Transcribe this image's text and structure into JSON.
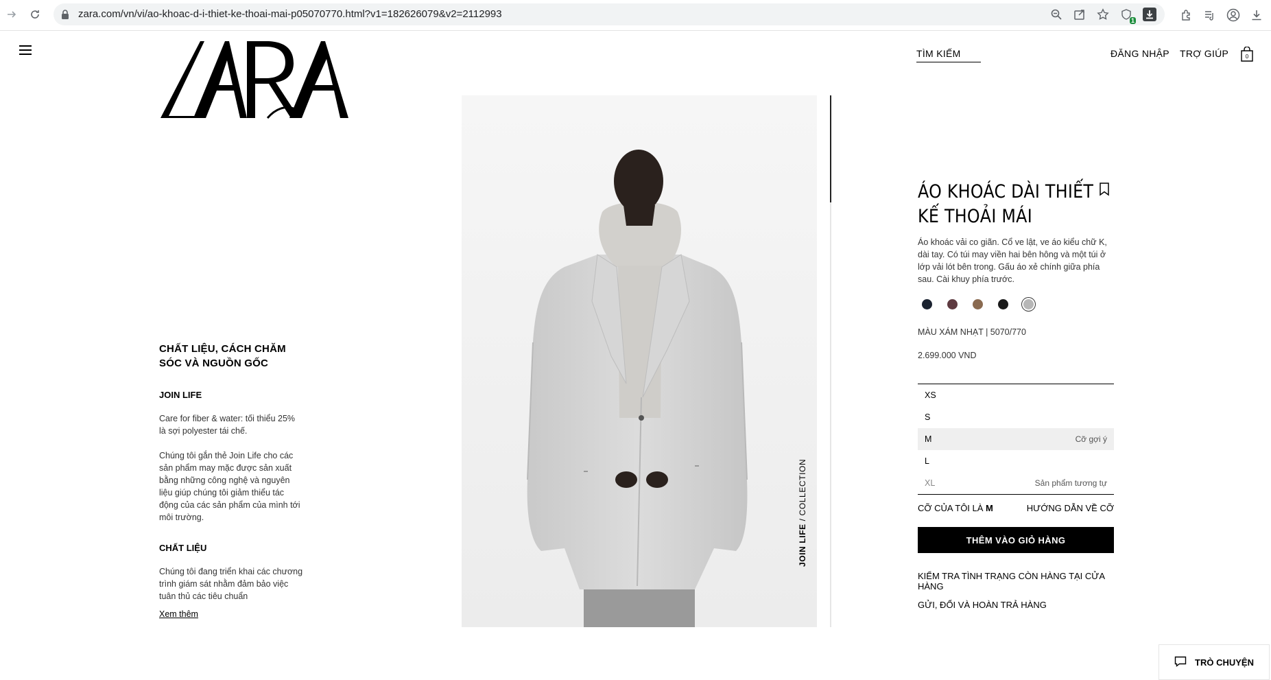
{
  "browser": {
    "url": "zara.com/vn/vi/ao-khoac-d-i-thiet-ke-thoai-mai-p05070770.html?v1=182626079&v2=2112993",
    "extension_badge": "1"
  },
  "header": {
    "logo_text": "ZARA",
    "search": "TÌM KIẾM",
    "login": "ĐĂNG NHẬP",
    "help": "TRỢ GIÚP"
  },
  "left_info": {
    "section_title": "CHẤT LIỆU, CÁCH CHĂM SÓC VÀ NGUỒN GỐC",
    "joinlife_heading": "JOIN LIFE",
    "joinlife_text1": "Care for fiber & water: tối thiểu 25% là sợi polyester tái chế.",
    "joinlife_text2": "Chúng tôi gắn thẻ Join Life cho các sản phẩm may mặc được sản xuất bằng những công nghệ và nguyên liệu giúp chúng tôi giảm thiểu tác động của các sản phẩm của mình tới môi trường.",
    "material_heading": "CHẤT LIỆU",
    "material_text": "Chúng tôi đang triển khai các chương trình giám sát nhằm đảm bảo việc tuân thủ các tiêu chuẩn",
    "more_link": "Xem thêm"
  },
  "image": {
    "collection_bold": "JOIN LIFE",
    "collection_rest": " / COLLECTION"
  },
  "product": {
    "title": "ÁO KHOÁC DÀI THIẾT KẾ THOẢI MÁI",
    "description": "Áo khoác vải co giãn. Cổ ve lật, ve áo kiểu chữ K, dài tay. Có túi may viền hai bên hông và một túi ở lớp vải lót bên trong. Gấu áo xẻ chính giữa phía sau. Cài khuy phía trước.",
    "colors": [
      {
        "hex": "#1b2330"
      },
      {
        "hex": "#5e3a40"
      },
      {
        "hex": "#8a6a50"
      },
      {
        "hex": "#1a1a1a"
      },
      {
        "hex": "#b7b7b7",
        "selected": true
      }
    ],
    "color_info": "MÀU XÁM NHẠT | 5070/770",
    "price": "2.699.000 VND",
    "sizes": [
      {
        "label": "XS",
        "note": ""
      },
      {
        "label": "S",
        "note": ""
      },
      {
        "label": "M",
        "note": "Cỡ gợi ý"
      },
      {
        "label": "L",
        "note": ""
      },
      {
        "label": "XL",
        "note": "Sản phẩm tương tự"
      }
    ],
    "my_size_prefix": "CỠ CỦA TÔI LÀ ",
    "my_size_value": "M",
    "size_guide": "HƯỚNG DẪN VỀ CỠ",
    "add_to_cart": "THÊM VÀO GIỎ HÀNG",
    "check_store": "KIỂM TRA TÌNH TRẠNG CÒN HÀNG TẠI CỬA HÀNG",
    "shipping": "GỬI, ĐỔI VÀ HOÀN TRẢ HÀNG"
  },
  "chat": {
    "label": "TRÒ CHUYỆN"
  }
}
